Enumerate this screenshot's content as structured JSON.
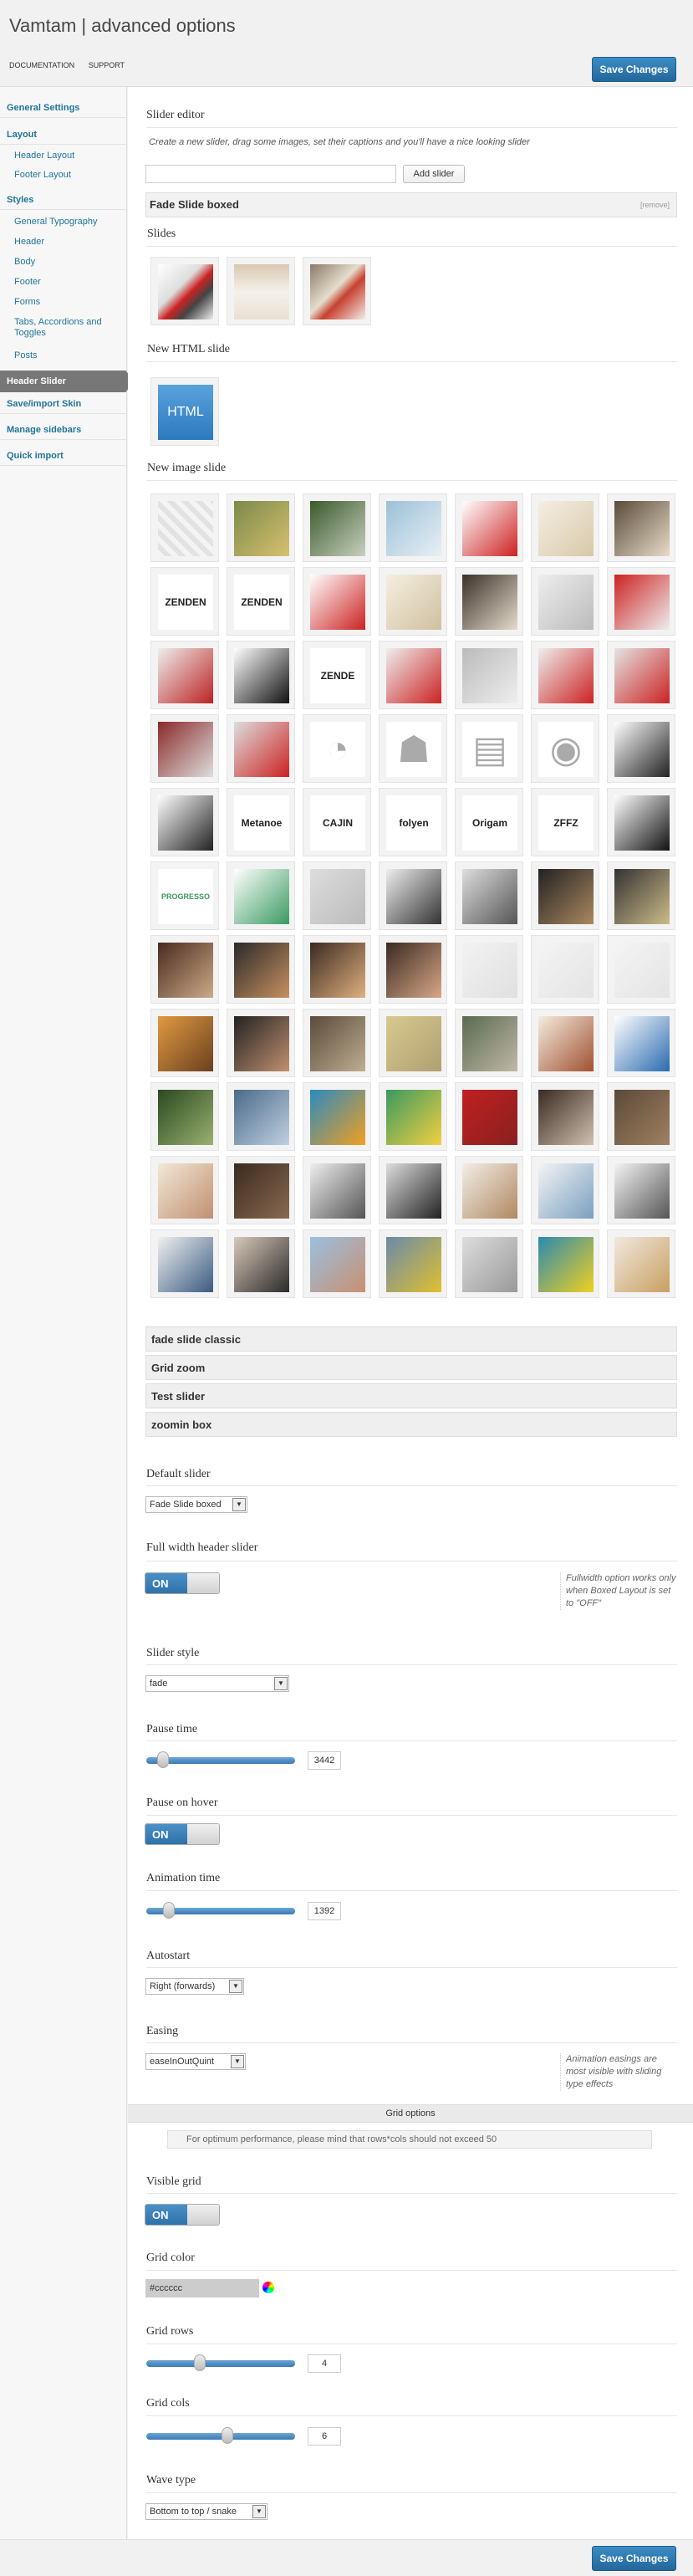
{
  "header": {
    "title": "Vamtam | advanced options",
    "links": [
      "DOCUMENTATION",
      "SUPPORT"
    ],
    "save_label": "Save Changes"
  },
  "sidebar": {
    "general": "General Settings",
    "layout": "Layout",
    "layout_sub": [
      "Header Layout",
      "Footer Layout"
    ],
    "styles": "Styles",
    "styles_sub": [
      "General Typography",
      "Header",
      "Body",
      "Footer",
      "Forms",
      "Tabs, Accordions and Toggles",
      "Posts"
    ],
    "active": "Header Slider",
    "rest": [
      "Save/import Skin",
      "Manage sidebars",
      "Quick import"
    ]
  },
  "slider_editor": {
    "title": "Slider editor",
    "hint": "Create a new slider, drag some images, set their captions and you'll have a nice looking slider",
    "add_button": "Add slider",
    "panel_title": "Fade Slide boxed",
    "remove_label": "[remove]",
    "slides_label": "Slides",
    "html_slide_label": "New HTML slide",
    "html_badge": "HTML",
    "image_slide_label": "New image slide",
    "logo_texts": [
      "ZENDEN",
      "ZENDEN",
      "ZENDE",
      "Metanoe",
      "CAJIN",
      "folyen",
      "Origam",
      "ZFFZ",
      "PROGRESSO"
    ],
    "accordions": [
      "fade slide classic",
      "Grid zoom",
      "Test slider",
      "zoomin box"
    ]
  },
  "settings": {
    "default_slider": {
      "label": "Default slider",
      "value": "Fade Slide boxed"
    },
    "full_width": {
      "label": "Full width header slider",
      "value": "ON",
      "note": "Fullwidth option works only when Boxed Layout is set to \"OFF\""
    },
    "slider_style": {
      "label": "Slider style",
      "value": "fade"
    },
    "pause_time": {
      "label": "Pause time",
      "value": "3442",
      "level": 0.08
    },
    "pause_on_hover": {
      "label": "Pause on hover",
      "value": "ON"
    },
    "animation_time": {
      "label": "Animation time",
      "value": "1392",
      "level": 0.12
    },
    "autostart": {
      "label": "Autostart",
      "value": "Right (forwards)"
    },
    "easing": {
      "label": "Easing",
      "value": "easeInOutQuint",
      "note": "Animation easings are most visible with sliding type effects"
    },
    "grid_options": "Grid options",
    "grid_info": "For optimum performance, please mind that rows*cols should not exceed 50",
    "visible_grid": {
      "label": "Visible grid",
      "value": "ON"
    },
    "grid_color": {
      "label": "Grid color",
      "value": "#cccccc"
    },
    "grid_rows": {
      "label": "Grid rows",
      "value": "4",
      "level": 0.35
    },
    "grid_cols": {
      "label": "Grid cols",
      "value": "6",
      "level": 0.55
    },
    "wave_type": {
      "label": "Wave type",
      "value": "Bottom to top / snake"
    }
  },
  "colors": {
    "accent": "#2e7bb1",
    "link": "#21759b",
    "sidebar_active": "#777777"
  }
}
